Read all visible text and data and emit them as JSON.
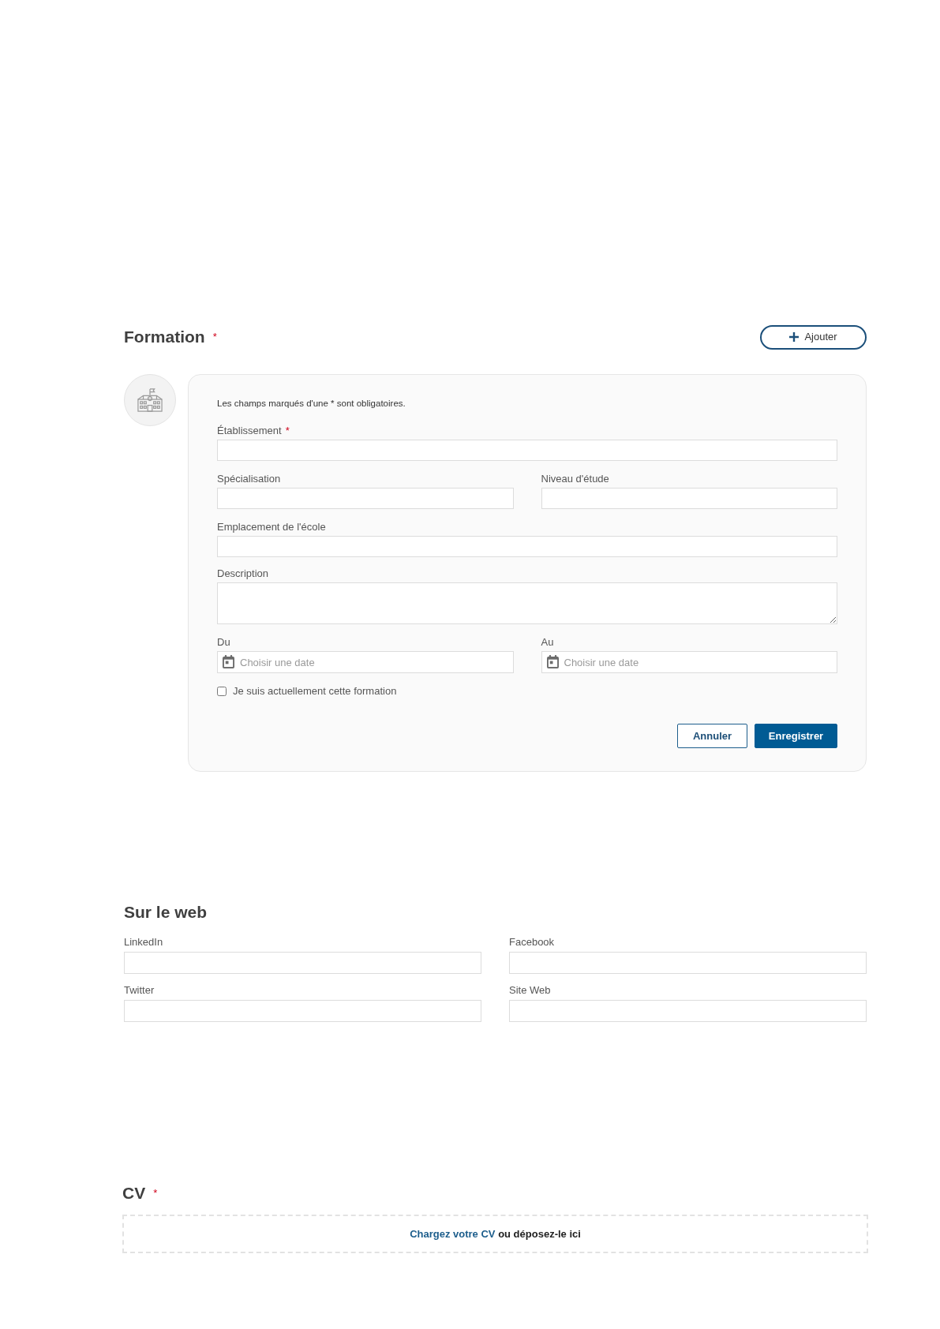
{
  "formation": {
    "title": "Formation",
    "required_mark": "*",
    "add_button": "Ajouter",
    "form": {
      "note": "Les champs marqués d'une * sont obligatoires.",
      "rows": [
        [
          {
            "kind": "text",
            "label": "Établissement",
            "required_mark": "*"
          }
        ],
        [
          {
            "kind": "text",
            "label": "Spécialisation"
          },
          {
            "kind": "text",
            "label": "Niveau d'étude"
          }
        ],
        [
          {
            "kind": "text",
            "label": "Emplacement de l'école"
          }
        ],
        [
          {
            "kind": "textarea",
            "label": "Description"
          }
        ],
        [
          {
            "kind": "date",
            "label": "Du",
            "placeholder": "Choisir une date"
          },
          {
            "kind": "date",
            "label": "Au",
            "placeholder": "Choisir une date"
          }
        ]
      ],
      "checkbox": {
        "label": "Je suis actuellement cette formation",
        "checked": false
      },
      "buttons": [
        {
          "kind": "secondary",
          "label": "Annuler"
        },
        {
          "kind": "primary",
          "label": "Enregistrer"
        }
      ]
    }
  },
  "on_the_web": {
    "title": "Sur le web",
    "fields": [
      {
        "label": "LinkedIn"
      },
      {
        "label": "Facebook"
      },
      {
        "label": "Twitter"
      },
      {
        "label": "Site Web"
      }
    ]
  },
  "cv": {
    "title": "CV",
    "required_mark": "*",
    "dropzone": {
      "link": "Chargez votre CV",
      "text": "ou déposez-le ici"
    }
  }
}
